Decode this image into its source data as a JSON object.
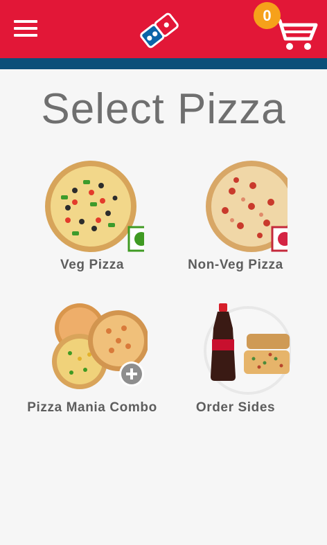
{
  "header": {
    "cart_count": "0",
    "colors": {
      "brand_red": "#e21737",
      "brand_blue": "#0b4f79",
      "badge_orange": "#f6a11a"
    },
    "icons": {
      "menu": "hamburger-menu-icon",
      "logo": "dominos-logo",
      "cart": "shopping-cart-icon"
    }
  },
  "main": {
    "title": "Select Pizza",
    "options": [
      {
        "label": "Veg Pizza",
        "badge": "veg-indicator-icon"
      },
      {
        "label": "Non-Veg Pizza",
        "badge": "non-veg-indicator-icon"
      },
      {
        "label": "Pizza Mania Combo",
        "badge": "plus-icon"
      },
      {
        "label": "Order Sides",
        "badge": ""
      }
    ]
  }
}
